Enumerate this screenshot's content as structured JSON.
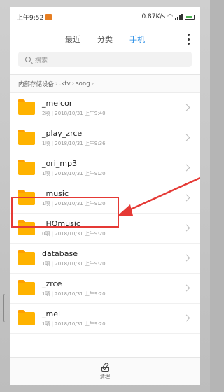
{
  "status_bar": {
    "time": "上午9:52",
    "speed": "0.87K/s"
  },
  "tabs": [
    {
      "label": "最近"
    },
    {
      "label": "分类"
    },
    {
      "label": "手机"
    }
  ],
  "search": {
    "placeholder": "搜索"
  },
  "breadcrumb": [
    "内部存储设备",
    ".ktv",
    "song"
  ],
  "files": [
    {
      "name": "_melcor",
      "meta": "2项 | 2018/10/31 上午9:40"
    },
    {
      "name": "_play_zrce",
      "meta": "1项 | 2018/10/31 上午9:36"
    },
    {
      "name": "_ori_mp3",
      "meta": "1项 | 2018/10/31 上午9:20"
    },
    {
      "name": "_music",
      "meta": "1项 | 2018/10/31 上午9:20"
    },
    {
      "name": "_HQmusic",
      "meta": "0项 | 2018/10/31 上午9:20"
    },
    {
      "name": "database",
      "meta": "1项 | 2018/10/31 上午9:20"
    },
    {
      "name": "_zrce",
      "meta": "1项 | 2018/10/31 上午9:20"
    },
    {
      "name": "_mel",
      "meta": "1项 | 2018/10/31 上午9:20"
    }
  ],
  "bottom_bar": {
    "label": "清理"
  },
  "colors": {
    "accent": "#1e88e5",
    "folder": "#ffb300",
    "annotation": "#e53935"
  },
  "icons": [
    "app-notification-icon",
    "wifi-icon",
    "signal-icon",
    "battery-icon",
    "more-icon",
    "search-icon",
    "folder-icon",
    "chevron-right-icon",
    "clean-icon"
  ]
}
